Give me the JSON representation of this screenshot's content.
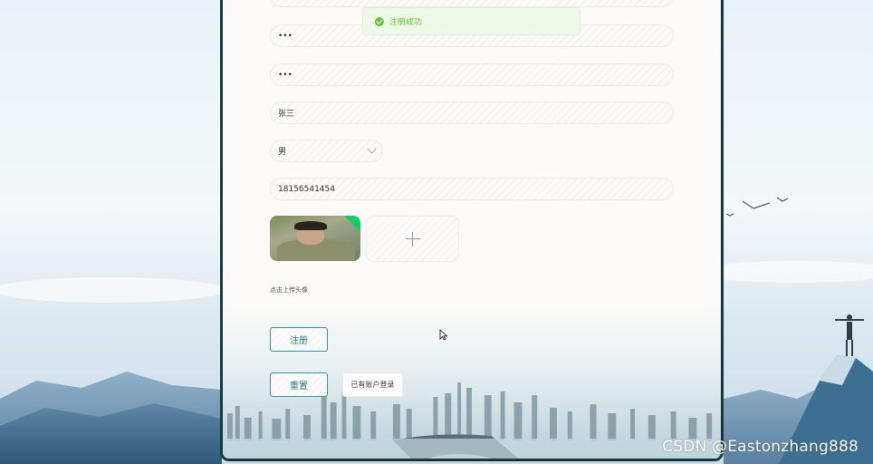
{
  "toast": {
    "message": "注册成功",
    "icon": "check-circle-icon",
    "color": "#67c23a"
  },
  "form": {
    "password": "•••",
    "confirm_password": "•••",
    "name": "张三",
    "gender": "男",
    "phone": "18156541454",
    "upload_hint": "点击上传头像"
  },
  "buttons": {
    "register": "注册",
    "reset": "重置",
    "login_link": "已有账户登录"
  },
  "watermark": "CSDN @Eastonzhang888",
  "colors": {
    "accent": "#2b7b86",
    "panel_border": "#13393f",
    "success": "#67c23a"
  }
}
